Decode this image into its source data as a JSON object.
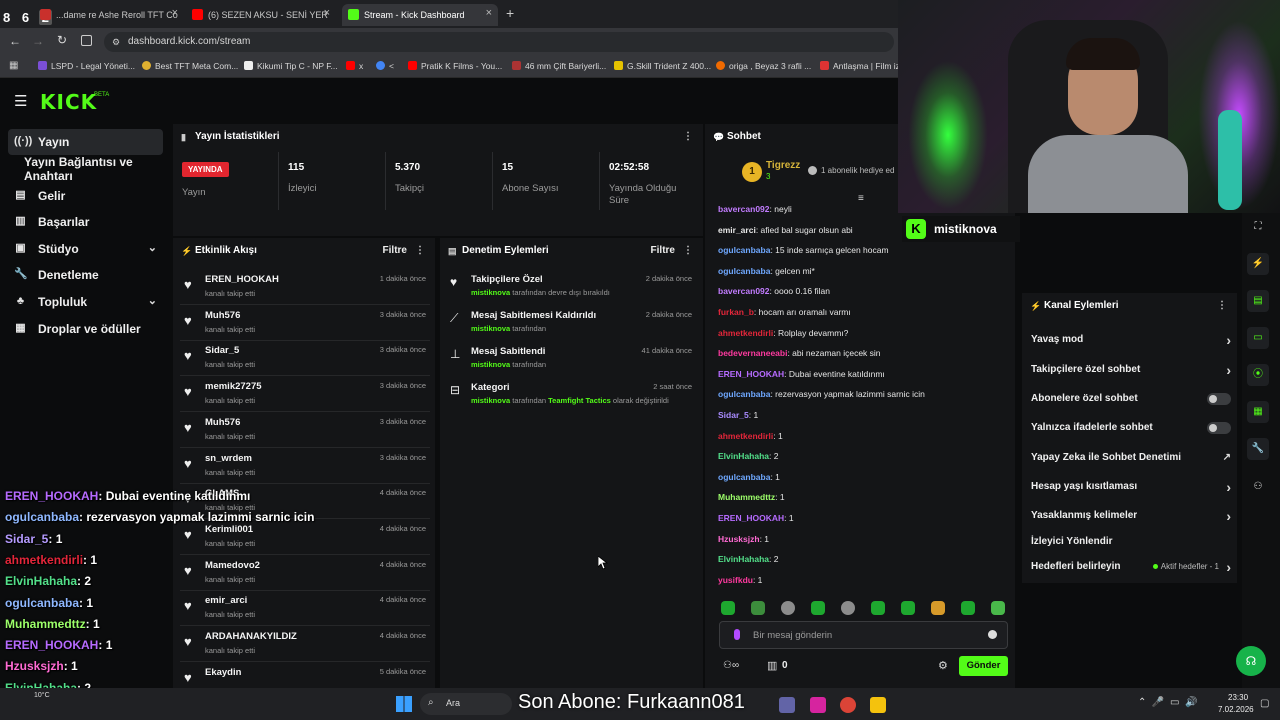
{
  "overlay_top": {
    "badges": [
      "8",
      "6",
      "2"
    ]
  },
  "browser": {
    "tabs": [
      {
        "label": "...dame re Ashe Reroll TFT Co",
        "icon_color": "#c9302c"
      },
      {
        "label": "(6) SEZEN AKSU - SENİ YER",
        "icon_color": "#ff0000"
      },
      {
        "label": "Stream - Kick Dashboard",
        "icon_color": "#53fc18"
      }
    ],
    "url": "dashboard.kick.com/stream",
    "bookmarks": [
      "LSPD - Legal Yöneti...",
      "Best TFT Meta Com...",
      "Kikumi Tip C - NP F...",
      "x",
      "<",
      "Pratik K Films - You...",
      "46 mm Çift Bariyerli...",
      "G.Skill Trident Z 400...",
      "origa , Beyaz 3 rafli ...",
      "Antlaşma | Film izle..."
    ]
  },
  "kick": {
    "logo": "KICK",
    "logo_beta": "BETA",
    "nav": [
      {
        "label": "Yayın",
        "icon": "broadcast-icon",
        "active": true
      },
      {
        "label": "Yayın Bağlantısı ve Anahtarı",
        "icon": "",
        "active": false
      },
      {
        "label": "Gelir",
        "icon": "revenue-icon"
      },
      {
        "label": "Başarılar",
        "icon": "achievements-icon"
      },
      {
        "label": "Stüdyo",
        "icon": "studio-icon",
        "expandable": true
      },
      {
        "label": "Denetleme",
        "icon": "moderation-icon"
      },
      {
        "label": "Topluluk",
        "icon": "community-icon",
        "expandable": true
      },
      {
        "label": "Droplar ve ödüller",
        "icon": "drops-icon"
      }
    ],
    "stats": {
      "title": "Yayın İstatistikleri",
      "live_badge": "YAYINDA",
      "live_label": "Yayın",
      "viewers": {
        "value": "115",
        "label": "İzleyici"
      },
      "followers": {
        "value": "5.370",
        "label": "Takipçi"
      },
      "subs": {
        "value": "15",
        "label": "Abone Sayısı"
      },
      "uptime": {
        "value": "02:52:58",
        "label": "Yayında Olduğu Süre"
      }
    },
    "activity": {
      "title": "Etkinlik Akışı",
      "filter": "Filtre",
      "items": [
        {
          "name": "EREN_HOOKAH",
          "sub": "kanalı takip etti",
          "time": "1 dakika önce"
        },
        {
          "name": "Muh576",
          "sub": "kanalı takip etti",
          "time": "3 dakika önce"
        },
        {
          "name": "Sidar_5",
          "sub": "kanalı takip etti",
          "time": "3 dakika önce"
        },
        {
          "name": "memik27275",
          "sub": "kanalı takip etti",
          "time": "3 dakika önce"
        },
        {
          "name": "Muh576",
          "sub": "kanalı takip etti",
          "time": "3 dakika önce"
        },
        {
          "name": "sn_wrdem",
          "sub": "kanalı takip etti",
          "time": "3 dakika önce"
        },
        {
          "name": "GLAMS",
          "sub": "kanalı takip etti",
          "time": "4 dakika önce"
        },
        {
          "name": "Kerimli001",
          "sub": "kanalı takip etti",
          "time": "4 dakika önce"
        },
        {
          "name": "Mamedovo2",
          "sub": "kanalı takip etti",
          "time": "4 dakika önce"
        },
        {
          "name": "emir_arci",
          "sub": "kanalı takip etti",
          "time": "4 dakika önce"
        },
        {
          "name": "ARDAHANAKYILDIZ",
          "sub": "kanalı takip etti",
          "time": "4 dakika önce"
        },
        {
          "name": "Ekaydin",
          "sub": "",
          "time": "5 dakika önce"
        }
      ]
    },
    "moderation": {
      "title": "Denetim Eylemleri",
      "filter": "Filtre",
      "items": [
        {
          "name": "Takipçilere Özel",
          "user": "mistiknova",
          "sub": "tarafından devre dışı bırakıldı",
          "time": "2 dakika önce",
          "icon": "heart-icon"
        },
        {
          "name": "Mesaj Sabitlemesi Kaldırıldı",
          "user": "mistiknova",
          "sub": "tarafından",
          "time": "2 dakika önce",
          "icon": "unpin-icon"
        },
        {
          "name": "Mesaj Sabitlendi",
          "user": "mistiknova",
          "sub": "tarafından",
          "time": "41 dakika önce",
          "icon": "pin-icon"
        },
        {
          "name": "Kategori",
          "user": "mistiknova",
          "sub": "tarafından",
          "highlight": "Teamfight Tactics",
          "sub2": "olarak değiştirildi",
          "time": "2 saat önce",
          "icon": "category-icon"
        }
      ]
    },
    "chat": {
      "title": "Sohbet",
      "pinned_user": "Tigrezz",
      "pinned_count": "3",
      "pinned_rank": "1",
      "gift_text": "1 abonelik hediye ed",
      "streamer_tag": "mistiknova",
      "messages": [
        {
          "user": "bavercan092",
          "text": ": neyli",
          "color": "#c27cff"
        },
        {
          "user": "emir_arci",
          "text": ": afied bal sugar olsun abi",
          "color": "#e7e7e7"
        },
        {
          "user": "ogulcanbaba",
          "text": ": 15 inde sarnıça gelcen hocam",
          "color": "#6fa8ff"
        },
        {
          "user": "ogulcanbaba",
          "text": ": gelcen mi*",
          "color": "#6fa8ff"
        },
        {
          "user": "bavercan092",
          "text": ": oooo 0.16 filan",
          "color": "#c27cff"
        },
        {
          "user": "furkan_b",
          "text": ": hocam arı oramalı varmı",
          "color": "#e3263a"
        },
        {
          "user": "ahmetkendirli",
          "text": ": Rolplay devammı?",
          "color": "#e3263a"
        },
        {
          "user": "bedevernaneeabi",
          "text": ": abi nezaman içecek sin",
          "color": "#ff3aa0"
        },
        {
          "user": "EREN_HOOKAH",
          "text": ": Dubai eventine katıldınmı",
          "color": "#b66bff"
        },
        {
          "user": "ogulcanbaba",
          "text": ": rezervasyon yapmak lazimmi sarnic icin",
          "color": "#6fa8ff"
        },
        {
          "user": "Sidar_5",
          "text": ": 1",
          "color": "#a98bff"
        },
        {
          "user": "ahmetkendirli",
          "text": ": 1",
          "color": "#e3263a"
        },
        {
          "user": "ElvinHahaha",
          "text": ": 2",
          "color": "#53e08a"
        },
        {
          "user": "ogulcanbaba",
          "text": ": 1",
          "color": "#6fa8ff"
        },
        {
          "user": "Muhammedttz",
          "text": ": 1",
          "color": "#9dff6a"
        },
        {
          "user": "EREN_HOOKAH",
          "text": ": 1",
          "color": "#b66bff"
        },
        {
          "user": "Hzusksjzh",
          "text": ": 1",
          "color": "#ff6bd3"
        },
        {
          "user": "ElvinHahaha",
          "text": ": 2",
          "color": "#53e08a"
        },
        {
          "user": "yusifkdu",
          "text": ": 1",
          "color": "#ff3aa0"
        }
      ],
      "input_placeholder": "Bir mesaj gönderin",
      "points_count": "0",
      "send_label": "Gönder"
    },
    "channel_actions": {
      "title": "Kanal Eylemleri",
      "items": [
        {
          "label": "Yavaş mod",
          "control": "arrow"
        },
        {
          "label": "Takipçilere özel sohbet",
          "control": "arrow"
        },
        {
          "label": "Abonelere özel sohbet",
          "control": "toggle"
        },
        {
          "label": "Yalnızca ifadelerle sohbet",
          "control": "toggle"
        },
        {
          "label": "Yapay Zeka ile Sohbet Denetimi",
          "control": "external"
        },
        {
          "label": "Hesap yaşı kısıtlaması",
          "control": "arrow"
        },
        {
          "label": "Yasaklanmış kelimeler",
          "control": "arrow"
        },
        {
          "label": "İzleyici Yönlendir",
          "control": "none"
        },
        {
          "label": "Hedefleri belirleyin",
          "control": "arrow",
          "extra": "Aktif hedefler - 1"
        }
      ]
    }
  },
  "overlay_chat": [
    {
      "user": "EREN_HOOKAH",
      "text": ": Dubai eventine katıldınmı",
      "color": "#b66bff"
    },
    {
      "user": "ogulcanbaba",
      "text": ": rezervasyon yapmak lazimmi sarnic icin",
      "color": "#8fb8ff"
    },
    {
      "user": "Sidar_5",
      "text": ": 1",
      "color": "#b59bff"
    },
    {
      "user": "ahmetkendirli",
      "text": ": 1",
      "color": "#e3263a"
    },
    {
      "user": "ElvinHahaha",
      "text": ": 2",
      "color": "#53e08a"
    },
    {
      "user": "ogulcanbaba",
      "text": ": 1",
      "color": "#8fb8ff"
    },
    {
      "user": "Muhammedttz",
      "text": ": 1",
      "color": "#9dff6a"
    },
    {
      "user": "EREN_HOOKAH",
      "text": ": 1",
      "color": "#b66bff"
    },
    {
      "user": "Hzusksjzh",
      "text": ": 1",
      "color": "#ff6bd3"
    },
    {
      "user": "ElvinHahaha",
      "text": ": 2",
      "color": "#53e08a"
    },
    {
      "user": "yusifkdu",
      "text": ": 1",
      "color": "#ff3aa0"
    }
  ],
  "taskbar": {
    "weather": "10°C",
    "search_label": "Ara",
    "ticker": "Son Abone: Furkaann081",
    "time": "23:30",
    "date": "7.02.2026"
  }
}
